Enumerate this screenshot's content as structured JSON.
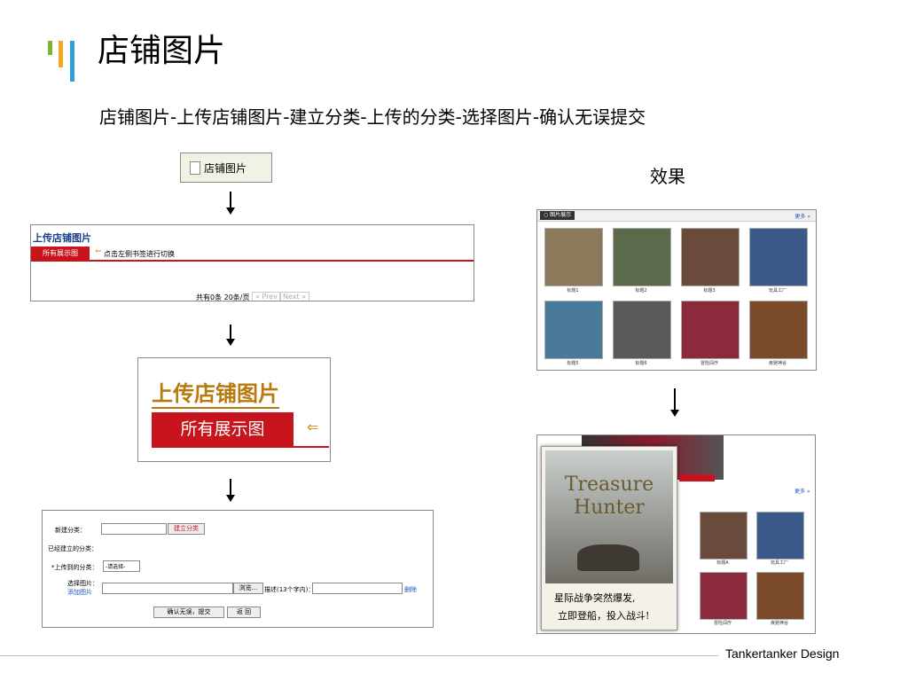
{
  "header": {
    "title": "店铺图片",
    "subtitle": "店铺图片-上传店铺图片-建立分类-上传的分类-选择图片-确认无误提交",
    "accent_colors": [
      "#7ab730",
      "#f5a623",
      "#2f9fd8"
    ]
  },
  "effect_label": "效果",
  "step1": {
    "label": "店铺图片"
  },
  "step2": {
    "title": "上传店铺图片",
    "tab": "所有展示图",
    "hint": "点击左侧书签进行切换",
    "pager": "共有0条 20条/页",
    "prev": "« Prev",
    "next": "Next »"
  },
  "step3": {
    "title": "上传店铺图片",
    "tab": "所有展示图"
  },
  "step4": {
    "new_category_label": "新建分类：",
    "create_button": "建立分类",
    "existing_label": "已经建立的分类：",
    "upload_category_label": "*上传到的分类：",
    "select_placeholder": "-请选择-",
    "choose_image_label": "选择图片：",
    "add_image_link": "添加图片",
    "browse_button": "浏览...",
    "desc_label": "描述(13个字内)：",
    "delete_link": "删除",
    "submit_button": "确认无误，提交",
    "back_button": "返 回"
  },
  "gallery": {
    "header": "图片展示",
    "more": "更多 »",
    "captions": [
      "标题1",
      "标题2",
      "标题3",
      "玩具工厂",
      "标题5",
      "标题6",
      "冒险闯疗",
      "疾驰神谷"
    ]
  },
  "popup": {
    "ad_title": "Treasure Hunter",
    "line1": "星际战争突然爆发,",
    "line2": "立即登船，投入战斗!",
    "more": "更多 »",
    "captions": [
      "标题A",
      "玩具工厂",
      "冒险闯疗",
      "疾驰神谷"
    ]
  },
  "footer": "Tankertanker Design"
}
